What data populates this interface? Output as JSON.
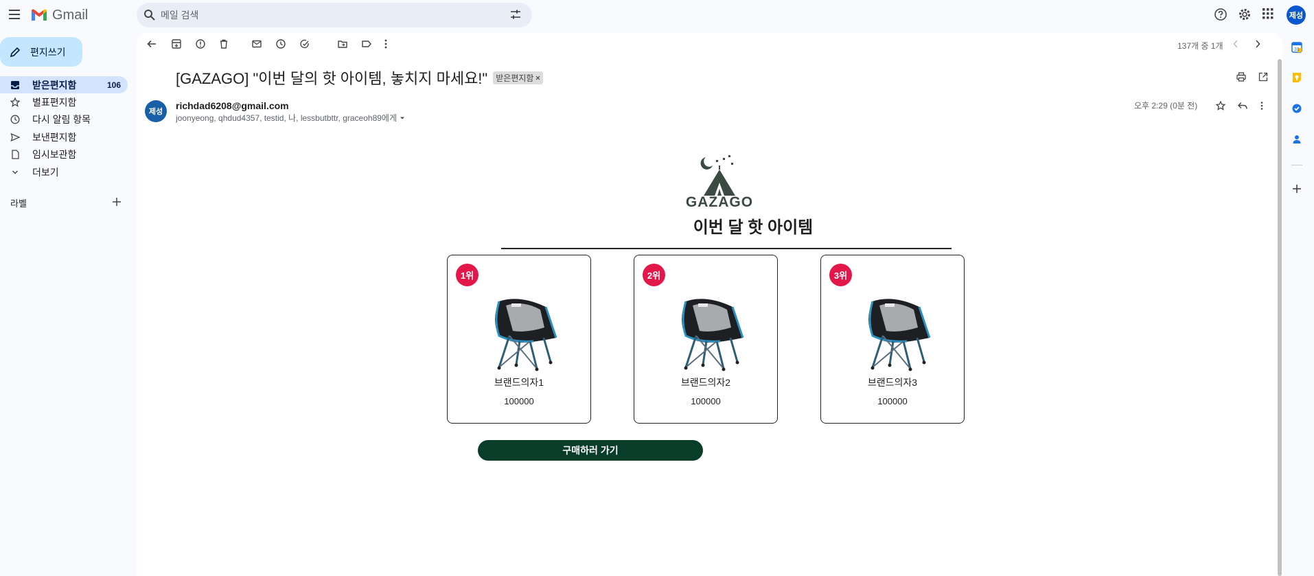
{
  "app": {
    "name": "Gmail"
  },
  "search": {
    "placeholder": "메일 검색"
  },
  "account": {
    "avatar_text": "제성"
  },
  "sidebar": {
    "compose_label": "편지쓰기",
    "items": [
      {
        "label": "받은편지함",
        "count": "106",
        "icon": "inbox-icon"
      },
      {
        "label": "별표편지함",
        "icon": "star-icon"
      },
      {
        "label": "다시 알림 항목",
        "icon": "clock-icon"
      },
      {
        "label": "보낸편지함",
        "icon": "send-icon"
      },
      {
        "label": "임시보관함",
        "icon": "draft-icon"
      },
      {
        "label": "더보기",
        "icon": "chevron-down-icon"
      }
    ],
    "labels_heading": "라벨"
  },
  "toolbar": {
    "page_count": "137개 중 1개"
  },
  "message": {
    "subject": "[GAZAGO] \"이번 달의 핫 아이템, 놓치지 마세요!\"",
    "label_badge": "받은편지함",
    "sender_avatar": "제성",
    "sender": "richdad6208@gmail.com",
    "recipients": "joonyeong, qhdud4357, testid, 나, lessbutbttr, graceoh89에게",
    "time": "오후 2:29 (0분 전)"
  },
  "email_body": {
    "brand": "GAZAGO",
    "heading": "이번 달 핫 아이템",
    "products": [
      {
        "rank": "1위",
        "name": "브랜드의자1",
        "price": "100000"
      },
      {
        "rank": "2위",
        "name": "브랜드의자2",
        "price": "100000"
      },
      {
        "rank": "3위",
        "name": "브랜드의자3",
        "price": "100000"
      }
    ],
    "buy_button": "구매하러 가기"
  },
  "colors": {
    "accent": "#0b57d0",
    "rank_badge": "#e4174b",
    "buy_button": "#073d29",
    "brand_logo": "#3b4a42"
  }
}
